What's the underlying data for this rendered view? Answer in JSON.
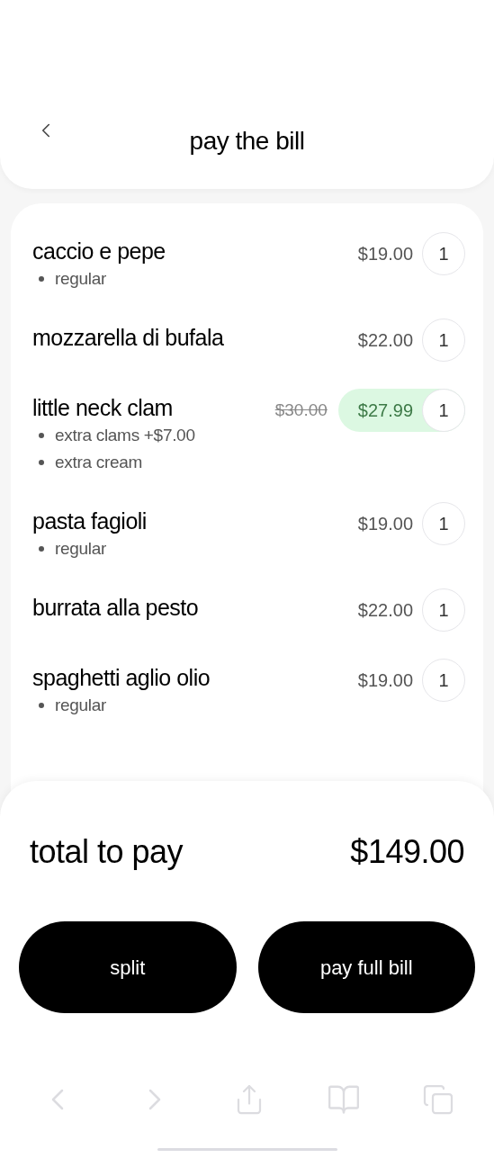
{
  "header": {
    "title": "pay the bill"
  },
  "items": [
    {
      "name": "caccio e pepe",
      "options": [
        "regular"
      ],
      "price": "$19.00",
      "quantity": "1",
      "discounted": false
    },
    {
      "name": "mozzarella di bufala",
      "price": "$22.00",
      "quantity": "1",
      "discounted": false
    },
    {
      "name": "little neck clam",
      "options": [
        "extra clams +$7.00",
        "extra cream"
      ],
      "original_price": "$30.00",
      "price": "$27.99",
      "quantity": "1",
      "discounted": true
    },
    {
      "name": "pasta fagioli",
      "options": [
        "regular"
      ],
      "price": "$19.00",
      "quantity": "1",
      "discounted": false
    },
    {
      "name": "burrata alla pesto",
      "price": "$22.00",
      "quantity": "1",
      "discounted": false
    },
    {
      "name": "spaghetti aglio olio",
      "options": [
        "regular"
      ],
      "price": "$19.00",
      "quantity": "1",
      "discounted": false
    }
  ],
  "total": {
    "label": "total to pay",
    "amount": "$149.00"
  },
  "buttons": [
    "split",
    "pay full bill"
  ]
}
